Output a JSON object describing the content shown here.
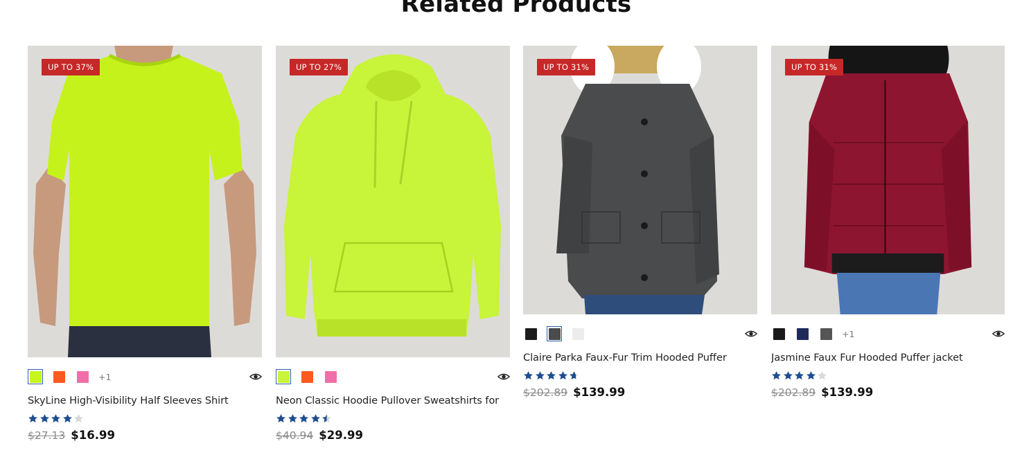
{
  "section": {
    "title": "Related Products"
  },
  "colors": {
    "badge": "#c62828",
    "star": "#1d4e8f",
    "star_empty": "#d8d8d8",
    "selected_border": "#2b5fb0"
  },
  "products": [
    {
      "badge": "UP TO 37%",
      "name": "SkyLine High-Visibility Half Sleeves Shirt",
      "old_price": "$27.13",
      "price": "$16.99",
      "rating": 4,
      "swatches": [
        "#c8f51c",
        "#ff5a1f",
        "#f06fa8"
      ],
      "selected_swatch": 0,
      "more_swatches": "+1",
      "image": "neon-green-t-shirt"
    },
    {
      "badge": "UP TO 27%",
      "name": "Neon Classic Hoodie Pullover Sweatshirts for",
      "old_price": "$40.94",
      "price": "$29.99",
      "rating": 4.5,
      "swatches": [
        "#c9f43a",
        "#ff5a1f",
        "#f06fa8"
      ],
      "selected_swatch": 0,
      "more_swatches": "",
      "image": "neon-green-hoodie"
    },
    {
      "badge": "UP TO 31%",
      "name": "Claire Parka Faux-Fur Trim Hooded Puffer",
      "old_price": "$202.89",
      "price": "$139.99",
      "rating": 4.7,
      "swatches": [
        "#1c1c1c",
        "#4b4b4b",
        "#ececec"
      ],
      "selected_swatch": 1,
      "more_swatches": "",
      "image": "grey-parka-jacket"
    },
    {
      "badge": "UP TO 31%",
      "name": "Jasmine Faux Fur Hooded Puffer jacket",
      "old_price": "$202.89",
      "price": "$139.99",
      "rating": 4,
      "swatches": [
        "#1a1a1a",
        "#1e2a5a",
        "#555555"
      ],
      "selected_swatch": -1,
      "more_swatches": "+1",
      "image": "burgundy-puffer-jacket"
    }
  ]
}
